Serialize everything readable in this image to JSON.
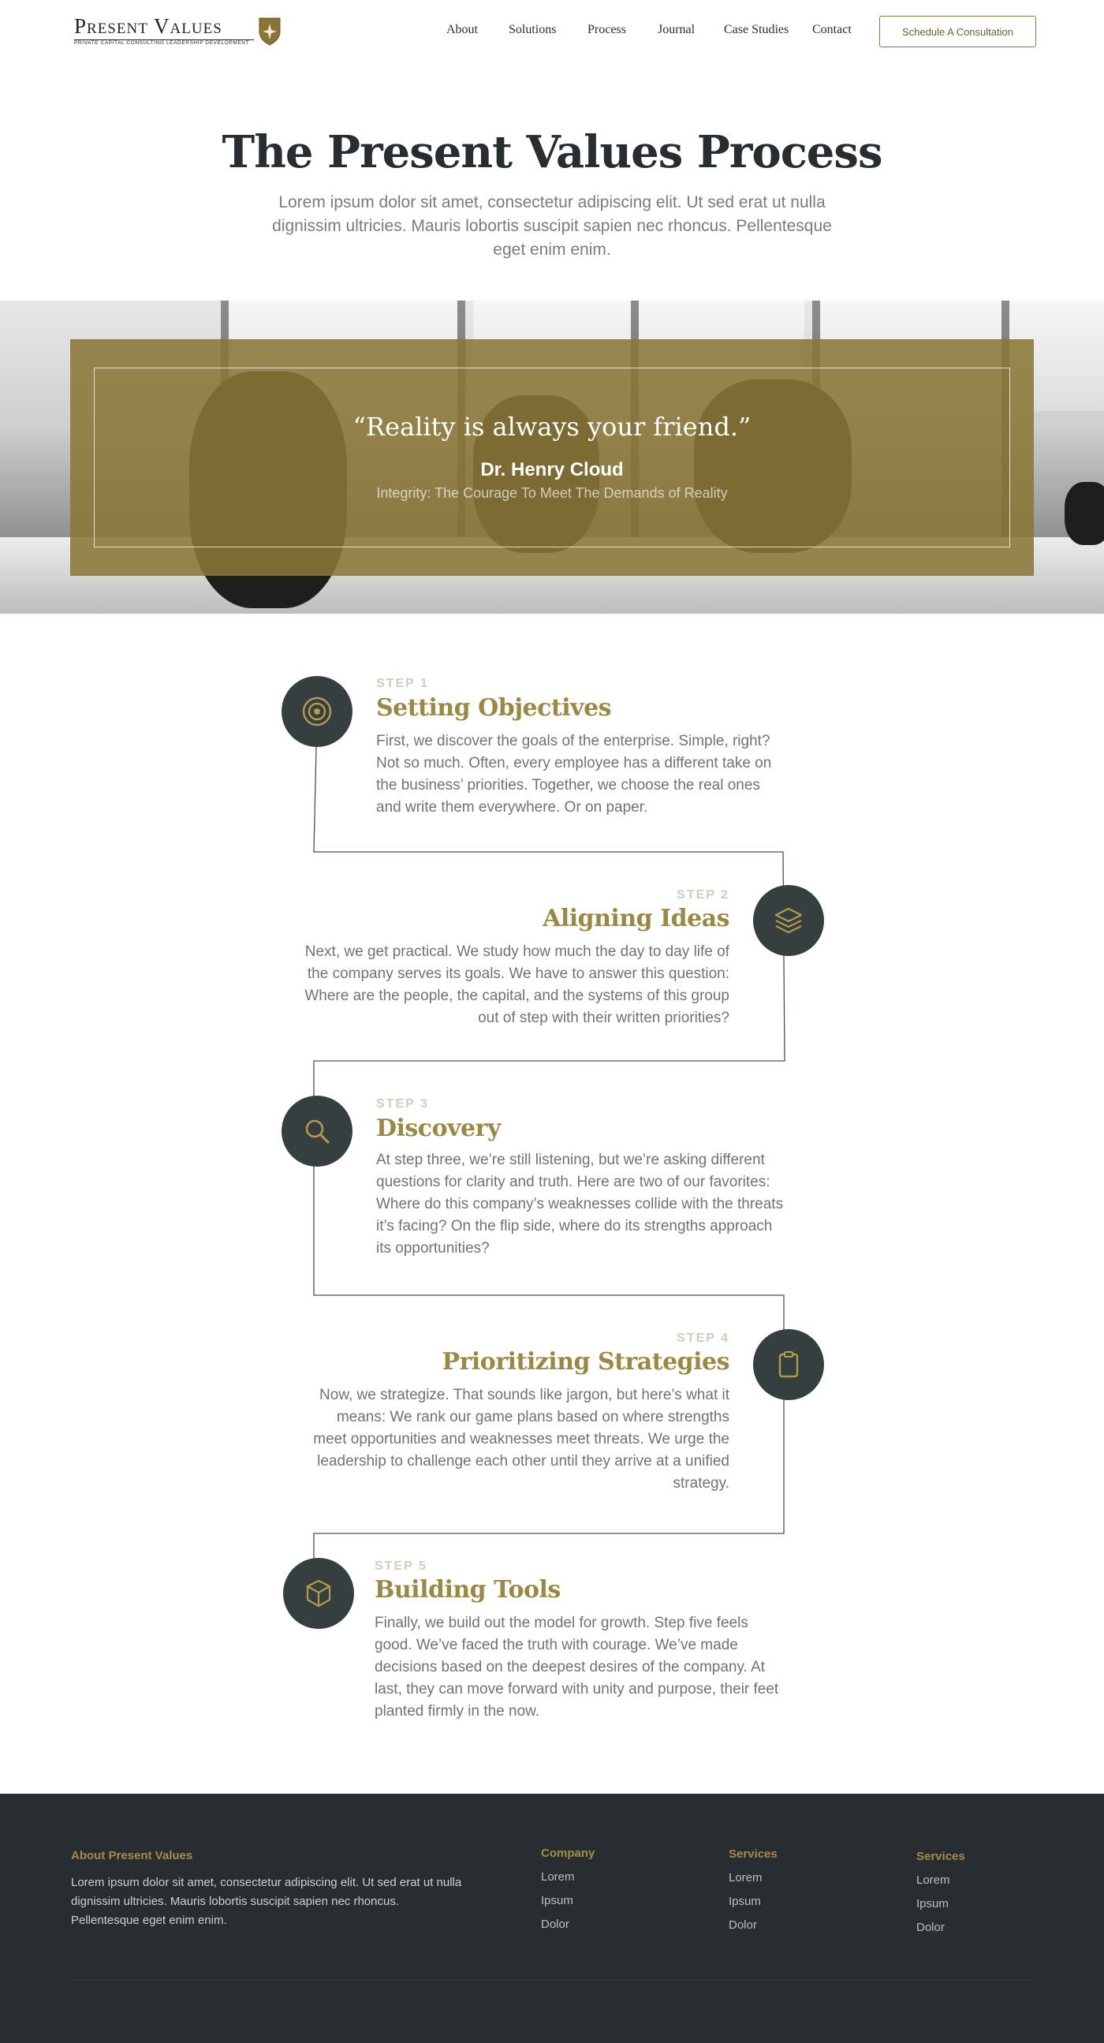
{
  "nav": {
    "logo_word": "Present Values",
    "logo_tagline": "PRIVATE CAPITAL   CONSULTING   LEADERSHIP DEVELOPMENT",
    "links": [
      "About",
      "Solutions",
      "Process",
      "Journal",
      "Case Studies",
      "Contact"
    ],
    "cta_label": "Schedule A Consultation"
  },
  "hero": {
    "title": "The Present Values Process",
    "subtitle": "Lorem ipsum dolor sit amet, consectetur adipiscing elit. Ut sed erat ut nulla dignissim ultricies. Mauris lobortis suscipit sapien nec rhoncus. Pellentesque eget enim enim."
  },
  "quote": {
    "text": "“Reality is always your friend.”",
    "author": "Dr. Henry Cloud",
    "source": "Integrity: The Courage To Meet The Demands of Reality"
  },
  "steps": [
    {
      "label": "STEP 1",
      "title": "Setting Objectives",
      "icon": "target-icon",
      "body": "First, we discover the goals of the enterprise. Simple, right? Not so much. Often, every employee has a different take on the business’ priorities. Together, we choose the real ones and write them everywhere.  Or on paper."
    },
    {
      "label": "STEP 2",
      "title": "Aligning Ideas",
      "icon": "layers-icon",
      "body": "Next, we get practical. We study how much the day to day life of the company serves its goals. We have to answer this question: Where are the people, the capital, and the systems of this group out of step with their written priorities?"
    },
    {
      "label": "STEP 3",
      "title": "Discovery",
      "icon": "search-icon",
      "body": "At step three, we’re still listening, but we’re asking different questions for clarity and truth. Here are two of our favorites: Where do this company’s weaknesses collide with the threats it’s facing? On the flip side, where do its strengths approach its opportunities?"
    },
    {
      "label": "STEP 4",
      "title": "Prioritizing Strategies",
      "icon": "clipboard-icon",
      "body": "Now, we strategize. That sounds like jargon, but here’s what it means: We rank our game plans based on where strengths meet opportunities and weaknesses meet threats. We urge the leadership to challenge each other until they arrive at a unified strategy."
    },
    {
      "label": "STEP 5",
      "title": "Building Tools",
      "icon": "box-icon",
      "body": "Finally, we build out the model for growth. Step five feels good. We’ve faced the truth with courage. We’ve made decisions based on the deepest desires of the company. At last, they can move forward with unity and purpose, their feet planted firmly in the now."
    }
  ],
  "footer": {
    "about_heading": "About Present Values",
    "about_text": "Lorem ipsum dolor sit amet, consectetur adipiscing elit. Ut sed erat ut nulla dignissim ultricies. Mauris lobortis suscipit sapien nec rhoncus. Pellentesque eget enim enim.",
    "columns": [
      {
        "heading": "Company",
        "links": [
          "Lorem",
          "Ipsum",
          "Dolor"
        ]
      },
      {
        "heading": "Services",
        "links": [
          "Lorem",
          "Ipsum",
          "Dolor"
        ]
      },
      {
        "heading": "Services",
        "links": [
          "Lorem",
          "Ipsum",
          "Dolor"
        ]
      }
    ]
  },
  "colors": {
    "accent_gold": "#9a8843",
    "dark_slate": "#272d30",
    "icon_circle": "#353f40"
  }
}
